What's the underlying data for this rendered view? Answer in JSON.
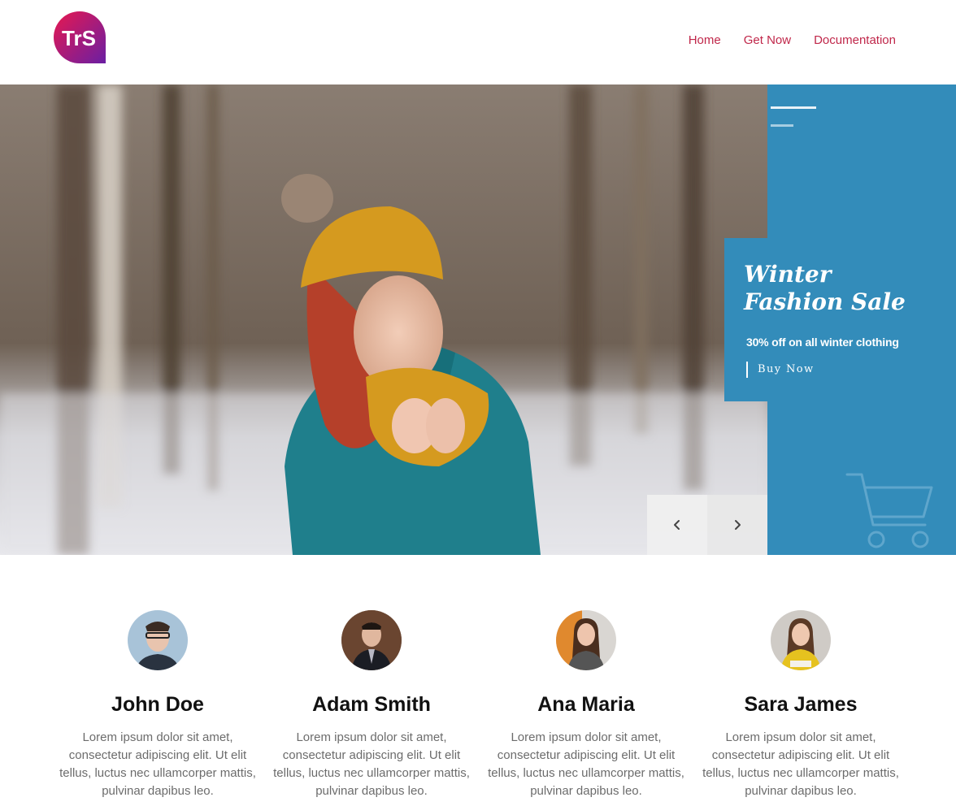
{
  "brand": {
    "logo_text": "TrS",
    "logo_gradient": [
      "#e8184f",
      "#6a1fa3"
    ]
  },
  "nav": {
    "items": [
      {
        "label": "Home"
      },
      {
        "label": "Get Now"
      },
      {
        "label": "Documentation"
      }
    ],
    "color": "#c0274a"
  },
  "hero": {
    "promo_title": "Winter Fashion Sale",
    "promo_subtitle": "30% off on all winter clothing",
    "cta_label": "Buy Now",
    "panel_color": "#338cba",
    "slider": {
      "prev_icon": "chevron-left-icon",
      "next_icon": "chevron-right-icon"
    },
    "cart_icon": "shopping-cart-icon"
  },
  "team": {
    "members": [
      {
        "name": "John Doe",
        "bio": "Lorem ipsum dolor sit amet, consectetur adipiscing elit. Ut elit tellus, luctus nec ullamcorper mattis, pulvinar dapibus leo."
      },
      {
        "name": "Adam Smith",
        "bio": "Lorem ipsum dolor sit amet, consectetur adipiscing elit. Ut elit tellus, luctus nec ullamcorper mattis, pulvinar dapibus leo."
      },
      {
        "name": "Ana Maria",
        "bio": "Lorem ipsum dolor sit amet, consectetur adipiscing elit. Ut elit tellus, luctus nec ullamcorper mattis, pulvinar dapibus leo."
      },
      {
        "name": "Sara James",
        "bio": "Lorem ipsum dolor sit amet, consectetur adipiscing elit. Ut elit tellus, luctus nec ullamcorper mattis, pulvinar dapibus leo."
      }
    ]
  }
}
